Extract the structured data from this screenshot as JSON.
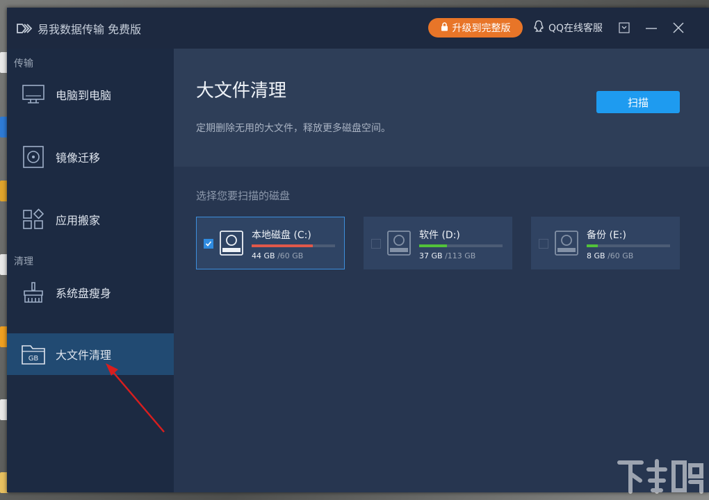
{
  "window": {
    "title": "易我数据传输 免费版"
  },
  "header": {
    "upgrade_label": "升级到完整版",
    "support_label": "QQ在线客服"
  },
  "sidebar": {
    "section_transfer": "传输",
    "section_clean": "清理",
    "items": [
      {
        "label": "电脑到电脑",
        "icon": "monitor-icon"
      },
      {
        "label": "镜像迁移",
        "icon": "disc-icon"
      },
      {
        "label": "应用搬家",
        "icon": "apps-icon"
      },
      {
        "label": "系统盘瘦身",
        "icon": "broom-icon"
      },
      {
        "label": "大文件清理",
        "icon": "gb-folder-icon",
        "active": true
      }
    ]
  },
  "main": {
    "title": "大文件清理",
    "subtitle": "定期删除无用的大文件，释放更多磁盘空间。",
    "scan_label": "扫描",
    "disk_prompt": "选择您要扫描的磁盘",
    "disks": [
      {
        "name": "本地磁盘 (C:)",
        "used": "44 GB",
        "total": "/60 GB",
        "usage": 0.73,
        "bar_color": "#e0584a",
        "selected": true
      },
      {
        "name": "软件 (D:)",
        "used": "37 GB",
        "total": "/113 GB",
        "usage": 0.33,
        "bar_color": "#52c23a",
        "selected": false
      },
      {
        "name": "备份 (E:)",
        "used": "8 GB",
        "total": "/60 GB",
        "usage": 0.13,
        "bar_color": "#52c23a",
        "selected": false
      }
    ]
  },
  "colors": {
    "accent": "#1e9bf0",
    "upgrade": "#e87528",
    "annotation": "#d81e1e"
  }
}
